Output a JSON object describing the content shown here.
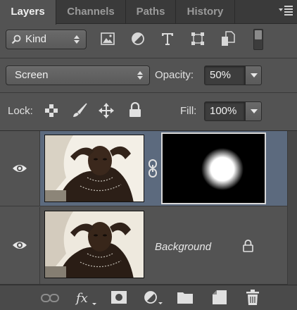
{
  "tabs": [
    {
      "label": "Layers",
      "active": true
    },
    {
      "label": "Channels",
      "active": false
    },
    {
      "label": "Paths",
      "active": false
    },
    {
      "label": "History",
      "active": false
    }
  ],
  "filter": {
    "kind_label": "Kind",
    "icons": [
      "image-filter-icon",
      "adjustment-filter-icon",
      "type-filter-icon",
      "shape-filter-icon",
      "smart-object-filter-icon"
    ]
  },
  "blend": {
    "mode": "Screen",
    "opacity_label": "Opacity:",
    "opacity_value": "50%"
  },
  "lock": {
    "label": "Lock:",
    "icons": [
      "lock-transparent-icon",
      "lock-image-icon",
      "lock-position-icon",
      "lock-all-icon"
    ],
    "fill_label": "Fill:",
    "fill_value": "100%"
  },
  "layers": [
    {
      "name": "",
      "selected": true,
      "visible": true,
      "has_mask": true,
      "linked": true
    },
    {
      "name": "Background",
      "selected": false,
      "visible": true,
      "locked": true
    }
  ],
  "footer_icons": [
    "link-layers-icon",
    "fx-icon",
    "add-mask-icon",
    "adjustment-layer-icon",
    "new-group-icon",
    "new-layer-icon",
    "delete-layer-icon"
  ],
  "colors": {
    "panel": "#535353",
    "selected_layer": "#5c6a7e",
    "tabbar": "#3a3a3a"
  }
}
